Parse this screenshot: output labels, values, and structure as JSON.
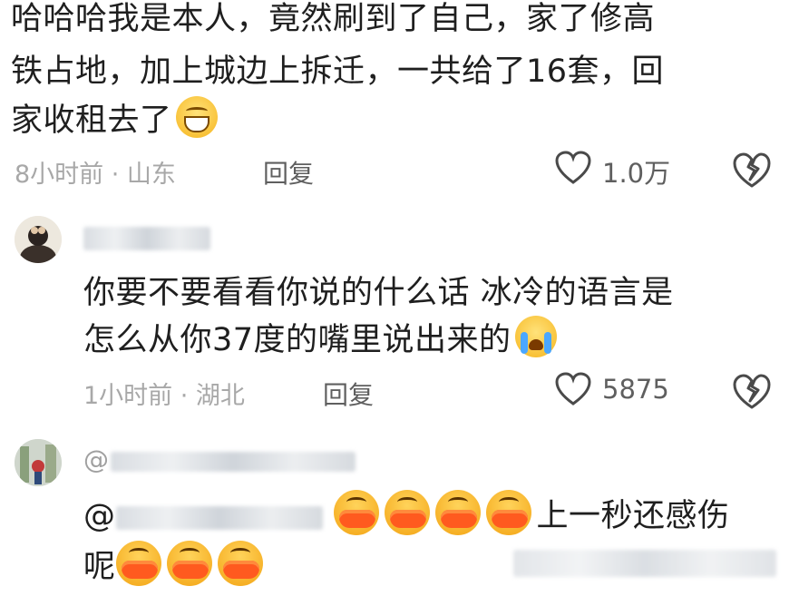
{
  "comment1": {
    "text_lines": [
      "哈哈哈我是本人，竟然刷到了自己，家了修高",
      "铁占地，加上城边上拆迁，一共给了16套，回",
      "家收租去了"
    ],
    "emoji": "grinning-face",
    "time_location": "8小时前 · 山东",
    "reply_label": "回复",
    "likes": "1.0万"
  },
  "comment2": {
    "text_lines": [
      "你要不要看看你说的什么话  冰冷的语言是",
      "怎么从你37度的嘴里说出来的"
    ],
    "emoji": "loudly-crying-face",
    "time_location": "1小时前 · 湖北",
    "reply_label": "回复",
    "likes": "5875"
  },
  "comment3": {
    "mention_prefix": "@",
    "text_line1_suffix": "上一秒还感伤",
    "text_line2": "呢",
    "emoji": "duck-laughing-face"
  },
  "colors": {
    "text": "#1f1f1f",
    "meta": "#a8a8a8",
    "action": "#5f5f5f"
  }
}
